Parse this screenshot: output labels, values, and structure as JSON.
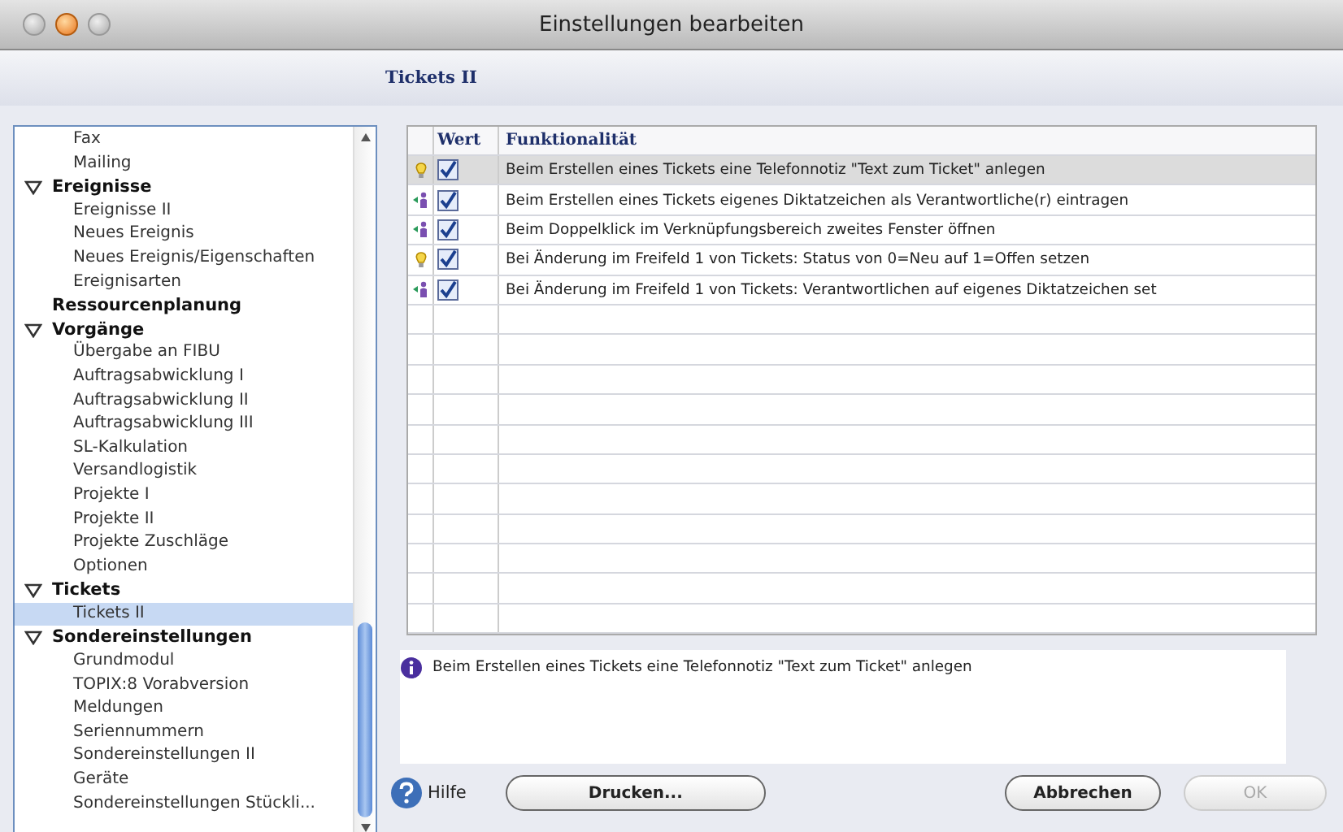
{
  "window": {
    "title": "Einstellungen bearbeiten"
  },
  "section_title": "Tickets II",
  "sidebar": {
    "items": [
      {
        "children": [
          {
            "label": "Fax",
            "selected": false
          },
          {
            "label": "Mailing",
            "selected": false
          }
        ]
      },
      {
        "label": "Ereignisse",
        "expanded": true,
        "children": [
          {
            "label": "Ereignisse II",
            "selected": false
          },
          {
            "label": "Neues Ereignis",
            "selected": false
          },
          {
            "label": "Neues Ereignis/Eigenschaften",
            "selected": false
          },
          {
            "label": "Ereignisarten",
            "selected": false
          }
        ]
      },
      {
        "label": "Ressourcenplanung"
      },
      {
        "label": "Vorgänge",
        "expanded": true,
        "children": [
          {
            "label": "Übergabe an FIBU",
            "selected": false
          },
          {
            "label": "Auftragsabwicklung I",
            "selected": false
          },
          {
            "label": "Auftragsabwicklung II",
            "selected": false
          },
          {
            "label": "Auftragsabwicklung III",
            "selected": false
          },
          {
            "label": "SL-Kalkulation",
            "selected": false
          },
          {
            "label": "Versandlogistik",
            "selected": false
          },
          {
            "label": "Projekte I",
            "selected": false
          },
          {
            "label": "Projekte II",
            "selected": false
          },
          {
            "label": "Projekte Zuschläge",
            "selected": false
          },
          {
            "label": "Optionen",
            "selected": false
          }
        ]
      },
      {
        "label": "Tickets",
        "expanded": true,
        "children": [
          {
            "label": "Tickets II",
            "selected": true
          }
        ]
      },
      {
        "label": "Sondereinstellungen",
        "expanded": true,
        "children": [
          {
            "label": "Grundmodul",
            "selected": false
          },
          {
            "label": "TOPIX:8 Vorabversion",
            "selected": false
          },
          {
            "label": "Meldungen",
            "selected": false
          },
          {
            "label": "Seriennummern",
            "selected": false
          },
          {
            "label": "Sondereinstellungen II",
            "selected": false
          },
          {
            "label": "Geräte",
            "selected": false
          },
          {
            "label": "Sondereinstellungen Stückli...",
            "selected": false
          }
        ]
      }
    ]
  },
  "table": {
    "columns": [
      "Wert",
      "Funktionalität"
    ],
    "rows": [
      {
        "kind": "bulb",
        "checked": true,
        "selected": true,
        "text": "Beim Erstellen eines Tickets eine Telefonnotiz \"Text zum Ticket\" anlegen"
      },
      {
        "kind": "person",
        "checked": true,
        "selected": false,
        "text": "Beim Erstellen eines Tickets eigenes Diktatzeichen als Verantwortliche(r) eintragen"
      },
      {
        "kind": "person",
        "checked": true,
        "selected": false,
        "text": "Beim Doppelklick im Verknüpfungsbereich zweites Fenster öffnen"
      },
      {
        "kind": "bulb",
        "checked": true,
        "selected": false,
        "text": "Bei Änderung im Freifeld 1 von Tickets: Status von 0=Neu auf 1=Offen setzen"
      },
      {
        "kind": "person",
        "checked": true,
        "selected": false,
        "text": "Bei Änderung im Freifeld 1 von Tickets: Verantwortlichen auf eigenes Diktatzeichen set"
      }
    ]
  },
  "description": "Beim Erstellen eines Tickets eine Telefonnotiz \"Text zum Ticket\" anlegen",
  "buttons": {
    "help": "Hilfe",
    "print": "Drucken...",
    "cancel": "Abbrechen",
    "ok": {
      "label": "OK",
      "disabled": true
    }
  }
}
